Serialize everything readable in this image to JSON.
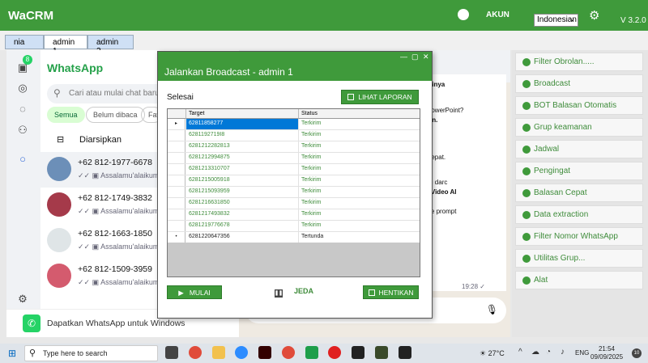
{
  "app": {
    "title": "WaCRM",
    "account_label": "AKUN",
    "language": "Indonesian",
    "version": "V 3.2.0"
  },
  "tabs": [
    {
      "label": "nia"
    },
    {
      "label": "admin 1"
    },
    {
      "label": "admin 2"
    }
  ],
  "whatsapp": {
    "title": "WhatsApp",
    "unread_badge": "8",
    "search_placeholder": "Cari atau mulai chat baru",
    "filters": [
      "Semua",
      "Belum dibaca",
      "Fav"
    ],
    "archived_label": "Diarsipkan",
    "contacts": [
      {
        "name": "+62 812-1977-6678",
        "preview": "Assalamu'alaikum ka"
      },
      {
        "name": "+62 812-1749-3832",
        "preview": "Assalamu'alaikum ka"
      },
      {
        "name": "+62 812-1663-1850",
        "preview": "Assalamu'alaikum ka"
      },
      {
        "name": "+62 812-1509-3959",
        "preview": "Assalamu'alaikum ka"
      }
    ],
    "download_banner": "Dapatkan WhatsApp untuk Windows",
    "message_lines": [
      "bdainya",
      "si PowerPoint?",
      "ahun.",
      "ng tepat.",
      "tang darc",
      "tor Video AI",
      "plate prompt"
    ],
    "message_time": "19:28"
  },
  "dialog": {
    "window_controls": [
      "—",
      "▢",
      "✕"
    ],
    "title": "Jalankan Broadcast - admin 1",
    "status_text": "Selesai",
    "report_button": "LIHAT LAPORAN",
    "columns": [
      "Target",
      "Status"
    ],
    "rows": [
      {
        "marker": "▸",
        "target": "62811858277",
        "status": "Terkirim"
      },
      {
        "marker": "",
        "target": "6281192719I8",
        "status": "Terkirim"
      },
      {
        "marker": "",
        "target": "6281212282813",
        "status": "Terkirim"
      },
      {
        "marker": "",
        "target": "6281212994875",
        "status": "Terkirim"
      },
      {
        "marker": "",
        "target": "6281213310707",
        "status": "Terkirim"
      },
      {
        "marker": "",
        "target": "6281215005918",
        "status": "Terkirim"
      },
      {
        "marker": "",
        "target": "6281215093959",
        "status": "Terkirim"
      },
      {
        "marker": "",
        "target": "6281216631850",
        "status": "Terkirim"
      },
      {
        "marker": "",
        "target": "6281217493832",
        "status": "Terkirim"
      },
      {
        "marker": "",
        "target": "6281219776678",
        "status": "Terkirim"
      },
      {
        "marker": "•",
        "target": "6281220647356",
        "status": "Tertunda"
      }
    ],
    "start_button": "MULAI",
    "pause_button": "JEDA",
    "stop_button": "HENTIKAN"
  },
  "right_panel": [
    {
      "label": "Filter Obrolan....."
    },
    {
      "label": "Broadcast"
    },
    {
      "label": "BOT Balasan Otomatis"
    },
    {
      "label": "Grup keamanan"
    },
    {
      "label": "Jadwal"
    },
    {
      "label": "Pengingat"
    },
    {
      "label": "Balasan Cepat"
    },
    {
      "label": "Data extraction"
    },
    {
      "label": "Filter Nomor WhatsApp"
    },
    {
      "label": "Utilitas Grup..."
    },
    {
      "label": "Alat"
    }
  ],
  "taskbar": {
    "search_placeholder": "Type here to search",
    "temperature": "27°C",
    "language": "ENG",
    "time": "21:54",
    "date": "09/09/2025",
    "notification_count": "10"
  },
  "colors": {
    "brand_green": "#3f9a3b",
    "selection_blue": "#0078d7",
    "wa_green": "#25d366"
  }
}
